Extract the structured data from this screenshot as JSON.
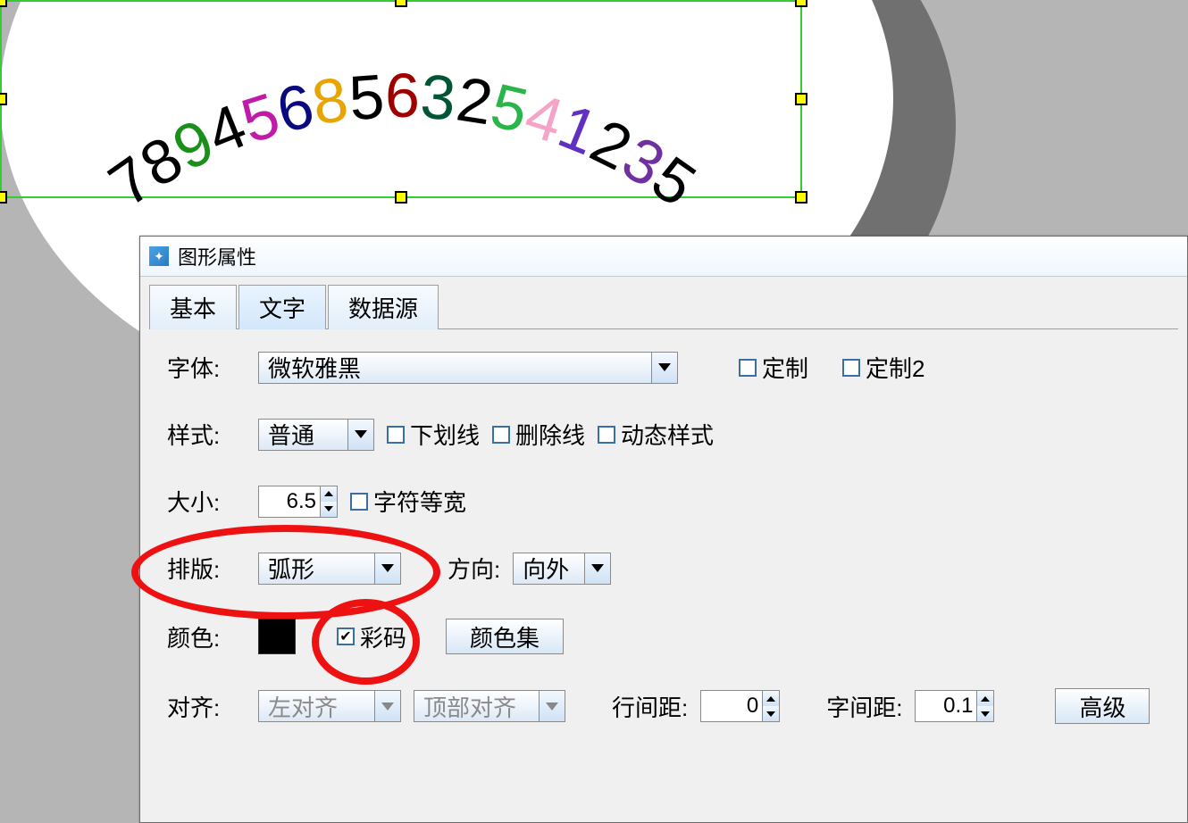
{
  "canvas_text": {
    "chars": [
      "7",
      "8",
      "9",
      "4",
      "5",
      "6",
      "8",
      "5",
      "6",
      "3",
      "2",
      "5",
      "4",
      "1",
      "2",
      "3",
      "5"
    ],
    "colors": [
      "#000000",
      "#000000",
      "#1a8f1a",
      "#000000",
      "#c01ba8",
      "#0a0a80",
      "#e8a400",
      "#000000",
      "#9e0000",
      "#005535",
      "#000000",
      "#2ab54a",
      "#f6a3c8",
      "#6030c0",
      "#000000",
      "#7030a0",
      "#000000"
    ]
  },
  "dialog": {
    "title": "图形属性",
    "tabs": {
      "basic": "基本",
      "text": "文字",
      "datasource": "数据源"
    },
    "font": {
      "label": "字体:",
      "value": "微软雅黑",
      "custom": "定制",
      "custom2": "定制2"
    },
    "style": {
      "label": "样式:",
      "value": "普通",
      "underline": "下划线",
      "strike": "删除线",
      "dynamic": "动态样式"
    },
    "size": {
      "label": "大小:",
      "value": "6.5",
      "mono": "字符等宽"
    },
    "layout": {
      "label": "排版:",
      "value": "弧形",
      "dir_label": "方向:",
      "dir_value": "向外"
    },
    "color": {
      "label": "颜色:",
      "rainbow": "彩码",
      "set_button": "颜色集"
    },
    "align": {
      "label": "对齐:",
      "h": "左对齐",
      "v": "顶部对齐",
      "line_spacing_label": "行间距:",
      "line_spacing_value": "0",
      "char_spacing_label": "字间距:",
      "char_spacing_value": "0.1",
      "advanced": "高级"
    }
  }
}
